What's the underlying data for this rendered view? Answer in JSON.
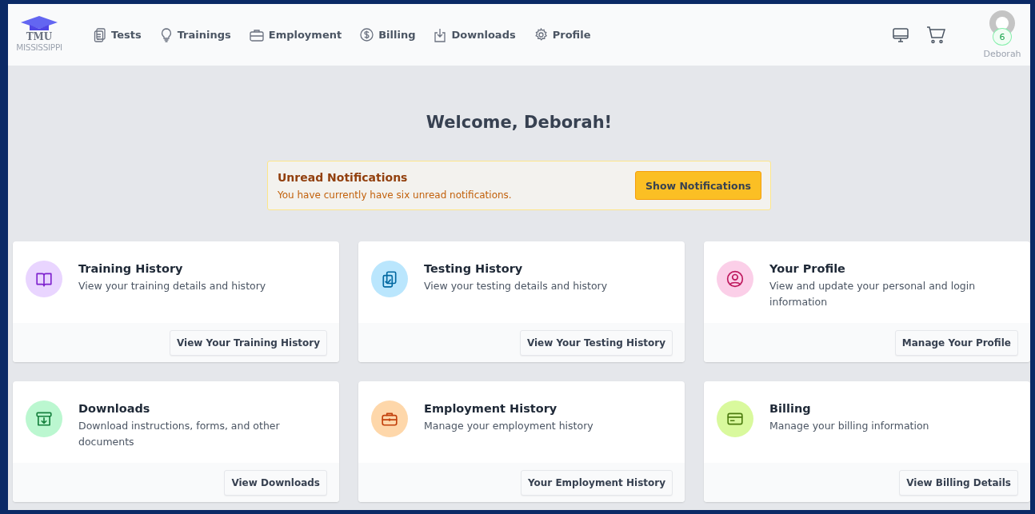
{
  "brand": {
    "name": "TMU",
    "state": "MISSISSIPPI"
  },
  "nav": [
    {
      "label": "Tests"
    },
    {
      "label": "Trainings"
    },
    {
      "label": "Employment"
    },
    {
      "label": "Billing"
    },
    {
      "label": "Downloads"
    },
    {
      "label": "Profile"
    }
  ],
  "user": {
    "badge": "6",
    "name": "Deborah"
  },
  "welcome": "Welcome, Deborah!",
  "notice": {
    "title": "Unread Notifications",
    "text": "You have currently have six unread notifications.",
    "button": "Show Notifications"
  },
  "cards": [
    {
      "title": "Training History",
      "text": "View your training details and history",
      "button": "View Your Training History",
      "color": "#e9d5ff"
    },
    {
      "title": "Testing History",
      "text": "View your testing details and history",
      "button": "View Your Testing History",
      "color": "#bae6fd"
    },
    {
      "title": "Your Profile",
      "text": "View and update your personal and login information",
      "button": "Manage Your Profile",
      "color": "#fbcfe8"
    },
    {
      "title": "Downloads",
      "text": "Download instructions, forms, and other documents",
      "button": "View Downloads",
      "color": "#bbf7d0"
    },
    {
      "title": "Employment History",
      "text": "Manage your employment history",
      "button": "Your Employment History",
      "color": "#fed7aa"
    },
    {
      "title": "Billing",
      "text": "Manage your billing information",
      "button": "View Billing Details",
      "color": "#d9f99d"
    }
  ]
}
